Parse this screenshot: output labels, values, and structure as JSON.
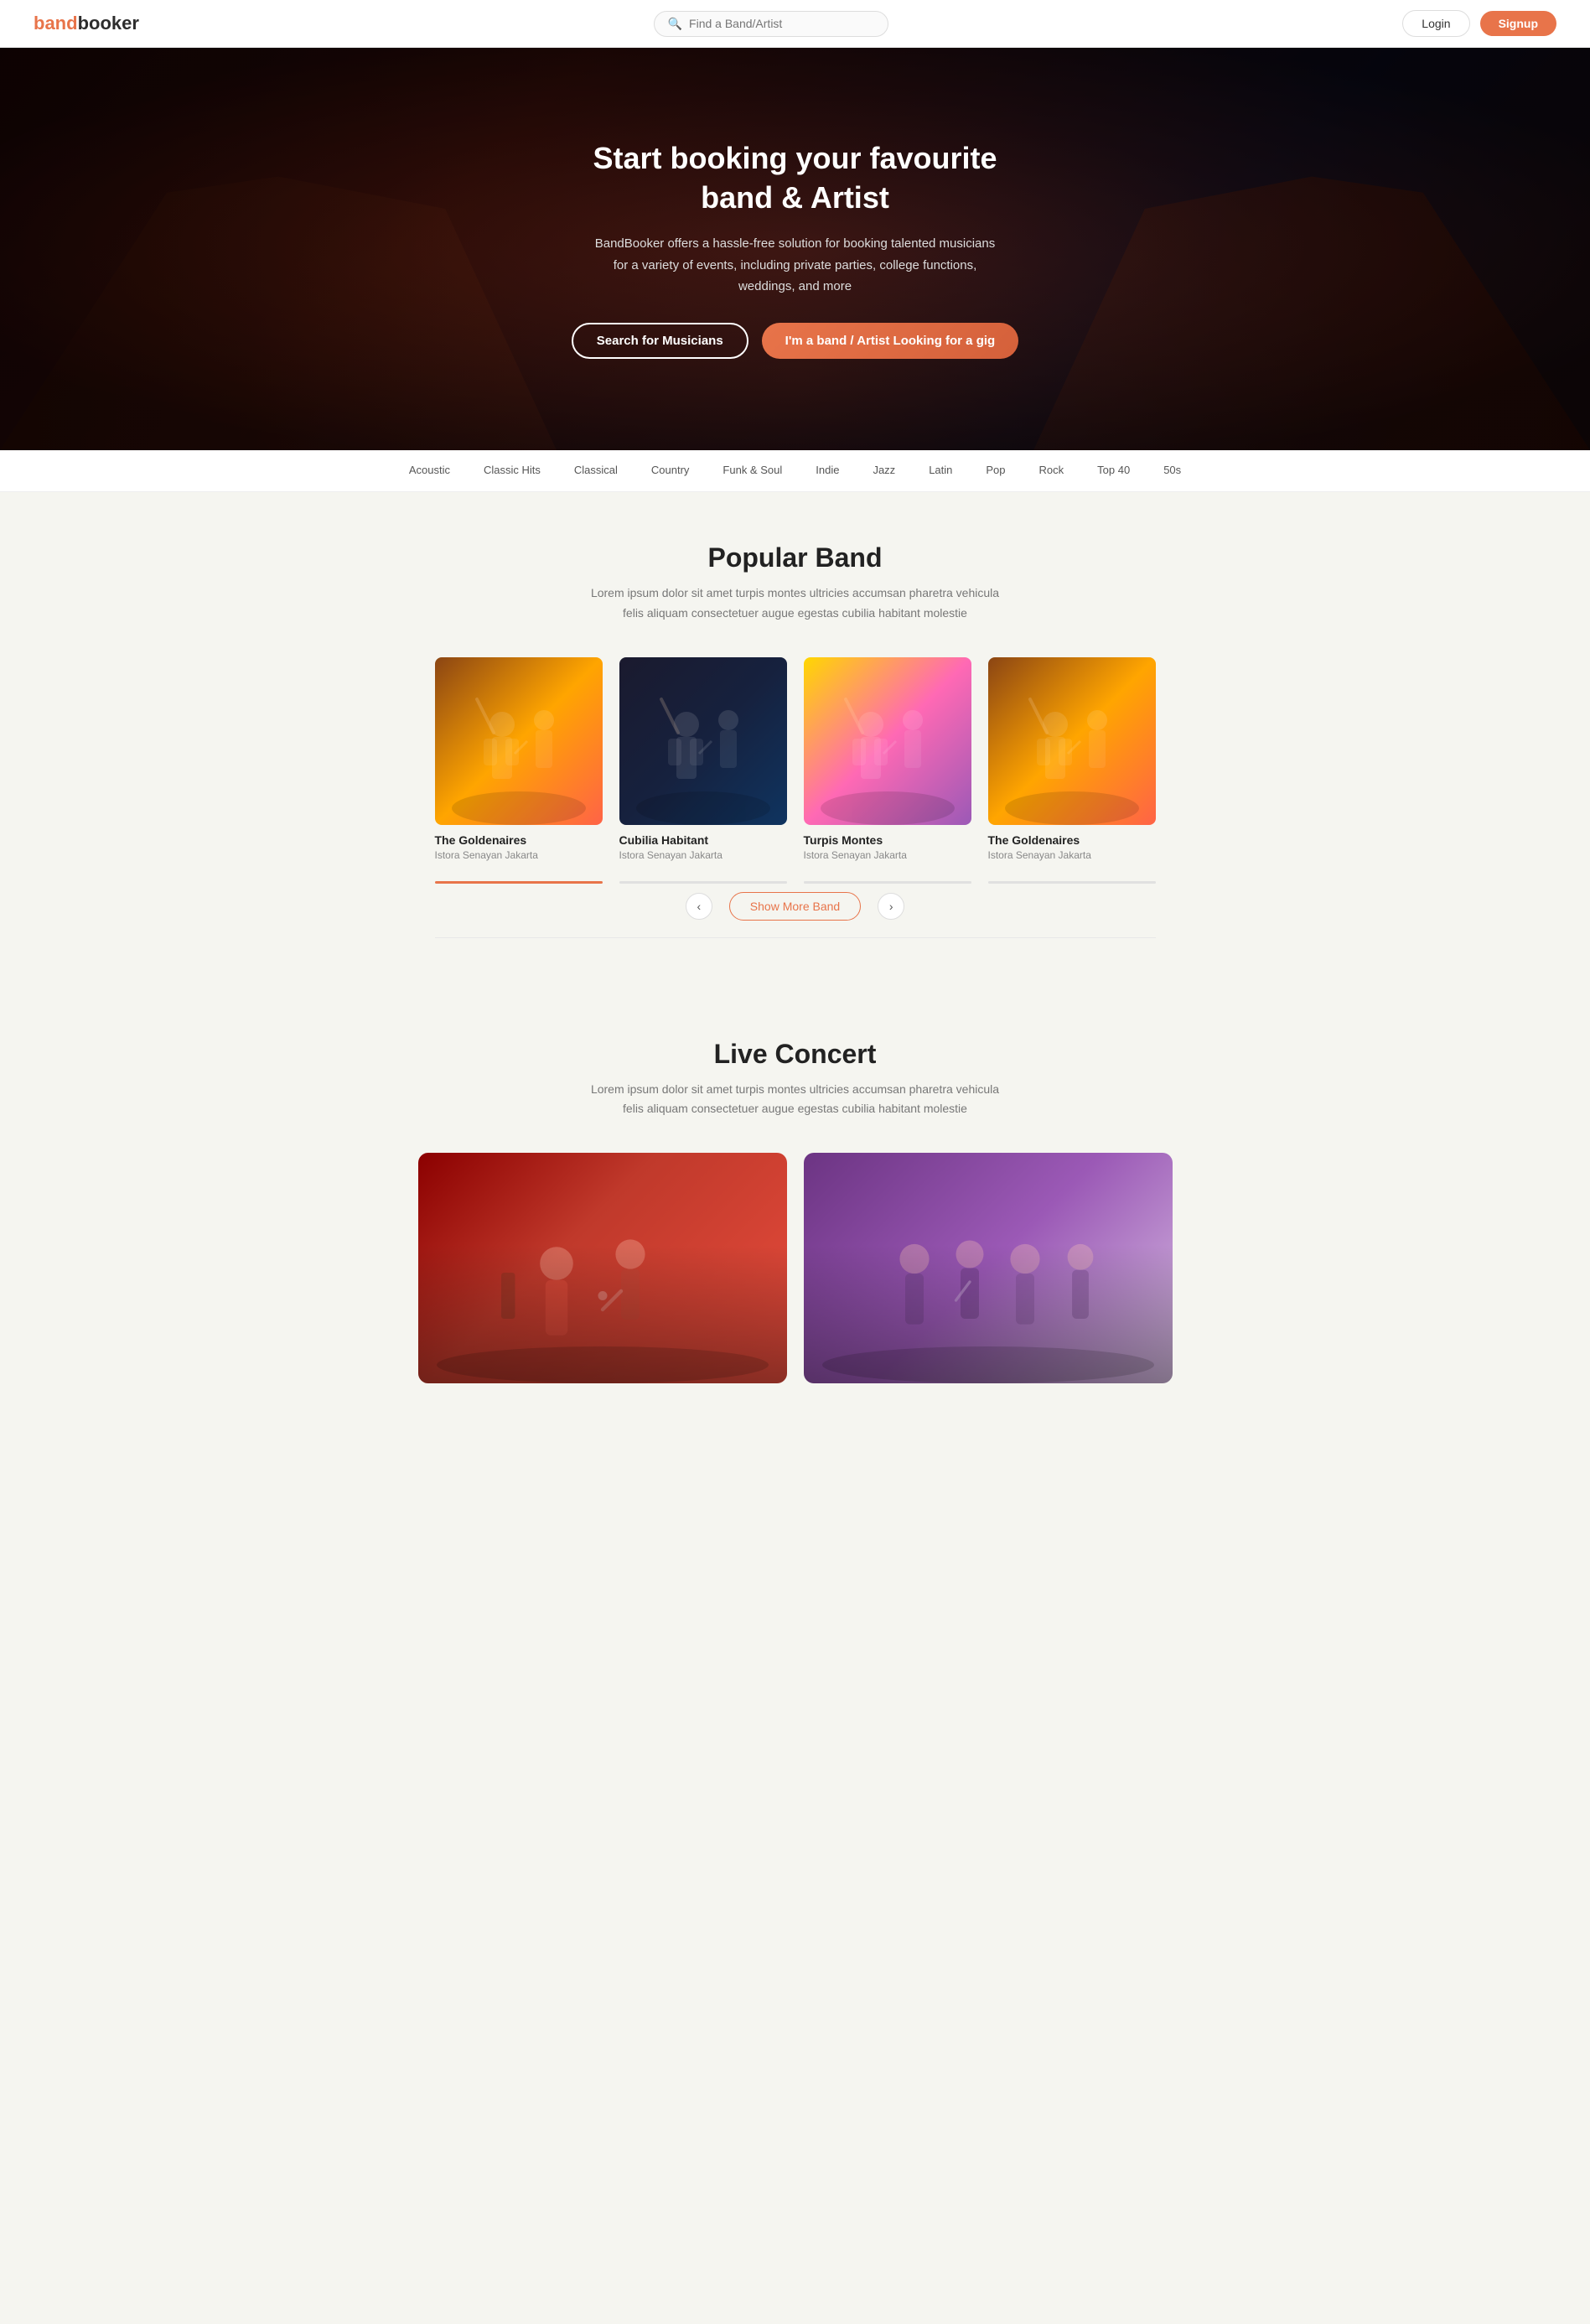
{
  "brand": {
    "name_part1": "band",
    "name_part2": "booker"
  },
  "navbar": {
    "search_placeholder": "Find a Band/Artist",
    "login_label": "Login",
    "signup_label": "Signup"
  },
  "hero": {
    "title": "Start booking your favourite band & Artist",
    "subtitle": "BandBooker offers a hassle-free solution for booking talented musicians for a variety of events, including private parties, college functions, weddings, and more",
    "btn_search": "Search for Musicians",
    "btn_band": "I'm a band / Artist Looking for a gig"
  },
  "genre_nav": {
    "items": [
      {
        "label": "Acoustic",
        "active": false
      },
      {
        "label": "Classic Hits",
        "active": false
      },
      {
        "label": "Classical",
        "active": false
      },
      {
        "label": "Country",
        "active": false
      },
      {
        "label": "Funk & Soul",
        "active": false
      },
      {
        "label": "Indie",
        "active": false
      },
      {
        "label": "Jazz",
        "active": false
      },
      {
        "label": "Latin",
        "active": false
      },
      {
        "label": "Pop",
        "active": false
      },
      {
        "label": "Rock",
        "active": false
      },
      {
        "label": "Top 40",
        "active": false
      },
      {
        "label": "50s",
        "active": false
      }
    ]
  },
  "popular_band": {
    "title": "Popular Band",
    "subtitle": "Lorem ipsum dolor sit amet turpis montes ultricies accumsan pharetra vehicula felis aliquam consectetuer augue egestas cubilia habitant molestie",
    "show_more_label": "Show More Band",
    "bands": [
      {
        "name": "The Goldenaires",
        "location": "Istora Senayan Jakarta",
        "img_class": "img-concert-1"
      },
      {
        "name": "Cubilia Habitant",
        "location": "Istora Senayan Jakarta",
        "img_class": "img-concert-2"
      },
      {
        "name": "Turpis Montes",
        "location": "Istora Senayan Jakarta",
        "img_class": "img-concert-3"
      },
      {
        "name": "The Goldenaires",
        "location": "Istora Senayan Jakarta",
        "img_class": "img-concert-4"
      }
    ],
    "prev_arrow": "‹",
    "next_arrow": "›"
  },
  "live_concert": {
    "title": "Live Concert",
    "subtitle": "Lorem ipsum dolor sit amet turpis montes ultricies accumsan pharetra vehicula felis aliquam consectetuer augue egestas cubilia habitant molestie",
    "concerts": [
      {
        "img_class": "concert-img-1"
      },
      {
        "img_class": "concert-img-2"
      }
    ]
  }
}
